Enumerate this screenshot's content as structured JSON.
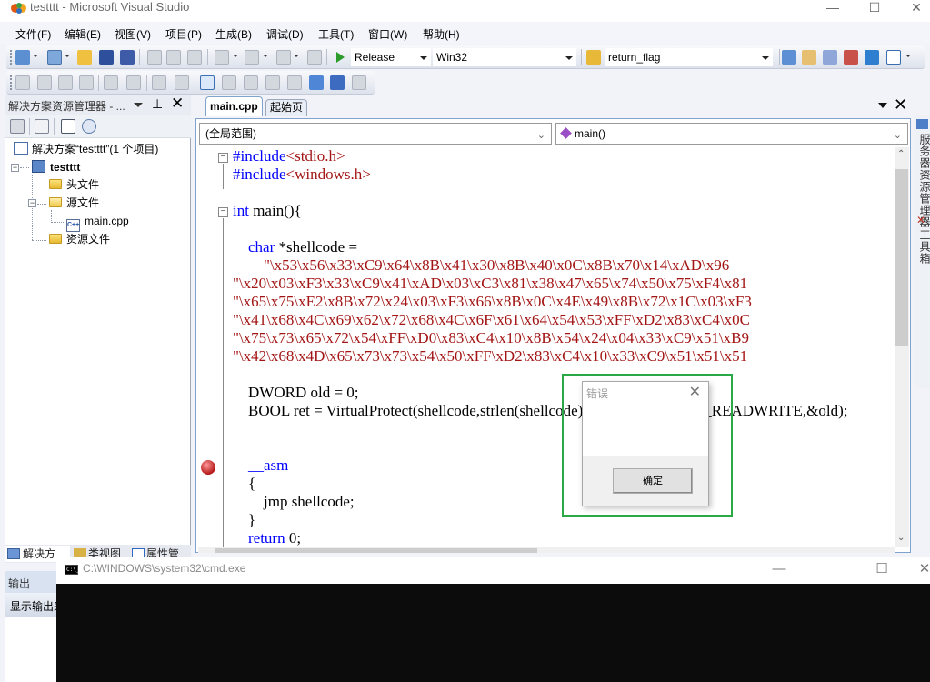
{
  "window": {
    "title": "testttt - Microsoft Visual Studio",
    "controls": {
      "minimize": "—",
      "maximize": "☐",
      "close": "✕"
    }
  },
  "menu": [
    "文件(F)",
    "编辑(E)",
    "视图(V)",
    "项目(P)",
    "生成(B)",
    "调试(D)",
    "工具(T)",
    "窗口(W)",
    "帮助(H)"
  ],
  "toolbar": {
    "configuration": "Release",
    "platform": "Win32",
    "find_combo": "return_flag",
    "icons": [
      "new-project-icon",
      "add-item-icon",
      "open-icon",
      "save-icon",
      "save-all-icon",
      "cut-icon",
      "copy-icon",
      "paste-icon",
      "undo-icon",
      "redo-icon",
      "navigate-back-icon",
      "navigate-forward-icon",
      "start-debug-icon",
      "find-in-files-icon",
      "solution-explorer-icon",
      "properties-icon",
      "object-browser-icon",
      "toolbox-icon",
      "start-page-icon",
      "command-window-icon"
    ]
  },
  "solution_explorer": {
    "title": "解决方案资源管理器 - ...",
    "tree": {
      "solution": "解决方案“testttt”(1 个项目)",
      "project": "testttt",
      "items": [
        {
          "label": "头文件",
          "type": "folder"
        },
        {
          "label": "源文件",
          "type": "folder-open"
        },
        {
          "label": "main.cpp",
          "type": "cpp-file"
        },
        {
          "label": "资源文件",
          "type": "folder"
        }
      ]
    },
    "bottom_tabs": [
      "解决方",
      "类视图",
      "属性管"
    ]
  },
  "output_panel": {
    "title": "输出",
    "show_output_from": "显示输出来"
  },
  "editor": {
    "tabs": [
      {
        "label": "main.cpp",
        "active": true
      },
      {
        "label": "起始页",
        "active": false
      }
    ],
    "scope_combo": "(全局范围)",
    "member_combo": "main()",
    "code_lines": [
      [
        {
          "t": "#include",
          "c": "kw"
        },
        {
          "t": "<stdio.h>",
          "c": "str"
        }
      ],
      [
        {
          "t": "#include",
          "c": "kw"
        },
        {
          "t": "<windows.h>",
          "c": "str"
        }
      ],
      [],
      [
        {
          "t": "int",
          "c": "kw"
        },
        {
          "t": " main(){",
          "c": ""
        }
      ],
      [],
      [
        {
          "t": "    ",
          "c": ""
        },
        {
          "t": "char",
          "c": "kw"
        },
        {
          "t": " *shellcode =",
          "c": ""
        }
      ],
      [
        {
          "t": "        \"\\x53\\x56\\x33\\xC9\\x64\\x8B\\x41\\x30\\x8B\\x40\\x0C\\x8B\\x70\\x14\\xAD\\x96",
          "c": "str"
        }
      ],
      [
        {
          "t": "\"\\x20\\x03\\xF3\\x33\\xC9\\x41\\xAD\\x03\\xC3\\x81\\x38\\x47\\x65\\x74\\x50\\x75\\xF4\\x81",
          "c": "str"
        }
      ],
      [
        {
          "t": "\"\\x65\\x75\\xE2\\x8B\\x72\\x24\\x03\\xF3\\x66\\x8B\\x0C\\x4E\\x49\\x8B\\x72\\x1C\\x03\\xF3",
          "c": "str"
        }
      ],
      [
        {
          "t": "\"\\x41\\x68\\x4C\\x69\\x62\\x72\\x68\\x4C\\x6F\\x61\\x64\\x54\\x53\\xFF\\xD2\\x83\\xC4\\x0C",
          "c": "str"
        }
      ],
      [
        {
          "t": "\"\\x75\\x73\\x65\\x72\\x54\\xFF\\xD0\\x83\\xC4\\x10\\x8B\\x54\\x24\\x04\\x33\\xC9\\x51\\xB9",
          "c": "str"
        }
      ],
      [
        {
          "t": "\"\\x42\\x68\\x4D\\x65\\x73\\x73\\x54\\x50\\xFF\\xD2\\x83\\xC4\\x10\\x33\\xC9\\x51\\x51\\x51",
          "c": "str"
        }
      ],
      [],
      [
        {
          "t": "    DWORD old = 0;",
          "c": ""
        }
      ],
      [
        {
          "t": "    BOOL ret = VirtualProtect(shellcode,strlen(shellcode),PAGE_EXECUTE_READWRITE,&old);",
          "c": ""
        }
      ],
      [],
      [],
      [
        {
          "t": "    ",
          "c": ""
        },
        {
          "t": "__asm",
          "c": "kw"
        }
      ],
      [
        {
          "t": "    {",
          "c": ""
        }
      ],
      [
        {
          "t": "        jmp shellcode;",
          "c": ""
        }
      ],
      [
        {
          "t": "    }",
          "c": ""
        }
      ],
      [
        {
          "t": "    ",
          "c": ""
        },
        {
          "t": "return",
          "c": "kw"
        },
        {
          "t": " 0;",
          "c": ""
        }
      ]
    ],
    "breakpoint_line": 18
  },
  "right_dock": {
    "tabs": [
      "服务器资源管理器",
      "工具箱"
    ]
  },
  "error_dialog": {
    "title": "错误",
    "message": "",
    "ok_label": "确定",
    "close": "✕"
  },
  "cmd_window": {
    "title": "C:\\WINDOWS\\system32\\cmd.exe",
    "icon_text": "C:\\_",
    "controls": {
      "minimize": "—",
      "maximize": "☐",
      "close": "✕"
    }
  }
}
